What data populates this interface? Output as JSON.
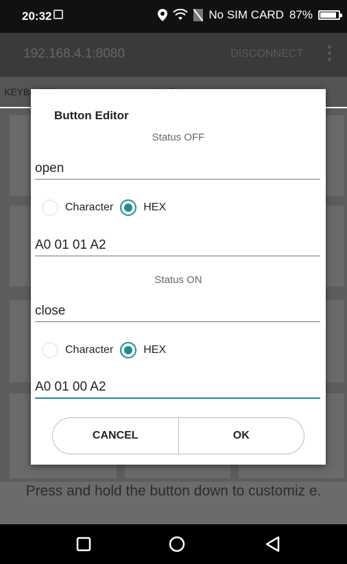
{
  "status_bar": {
    "time": "20:32",
    "carrier": "No SIM CARD",
    "battery": "87%",
    "battery_level": 0.87
  },
  "app_bar": {
    "title": "192.168.4.1:8080",
    "action": "DISCONNECT"
  },
  "tabs": [
    {
      "label": "KEYBOARD"
    },
    {
      "label": "SWITCH"
    }
  ],
  "dialog": {
    "title": "Button Editor",
    "off": {
      "heading": "Status OFF",
      "name_value": "open",
      "option_character": "Character",
      "option_hex": "HEX",
      "selected": "HEX",
      "data_value": "A0 01 01 A2"
    },
    "on": {
      "heading": "Status ON",
      "name_value": "close",
      "option_character": "Character",
      "option_hex": "HEX",
      "selected": "HEX",
      "data_value": "A0 01 00 A2"
    },
    "cancel_label": "CANCEL",
    "ok_label": "OK"
  },
  "hint": "Press and hold the button down to customiz e.",
  "colors": {
    "accent": "#1e8c8f",
    "status_bar": "#111111",
    "app_bar": "#3a3a3a"
  },
  "nav_icons": [
    "square-recent-icon",
    "circle-home-icon",
    "triangle-back-icon"
  ]
}
